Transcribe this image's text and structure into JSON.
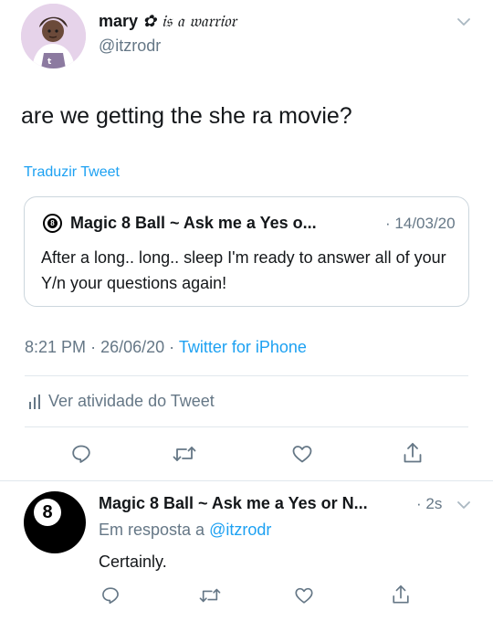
{
  "tweet": {
    "author_name": "mary",
    "author_name_decoration": "✿ 𝔦𝔰 𝔞 𝔴𝔞𝔯𝔯𝔦𝔬𝔯",
    "author_handle": "@itzrodr",
    "text": "are we getting the she ra movie?",
    "translate_label": "Traduzir Tweet",
    "time": "8:21 PM",
    "date": "26/06/20",
    "source": "Twitter for iPhone",
    "activity_label": "Ver atividade do Tweet"
  },
  "quoted_tweet": {
    "author_name": "Magic 8 Ball ~ Ask me a Yes o...",
    "date": "14/03/20",
    "text": "After a long.. long.. sleep I'm ready to answer all of your Y/n your questions again!",
    "icon_digit": "8"
  },
  "reply": {
    "author_name": "Magic 8 Ball ~ Ask me a Yes or N...",
    "time": "2s",
    "reply_prefix": "Em resposta a",
    "reply_to": "@itzrodr",
    "text": "Certainly.",
    "avatar_digit": "8"
  },
  "separators": {
    "dot": "·"
  },
  "icons": [
    "chevron-down-icon",
    "reply-icon",
    "retweet-icon",
    "like-icon",
    "share-icon",
    "activity-icon"
  ],
  "colors": {
    "accent": "#1da1f2",
    "muted": "#657786",
    "text": "#14171a",
    "border": "#e1e8ed"
  }
}
